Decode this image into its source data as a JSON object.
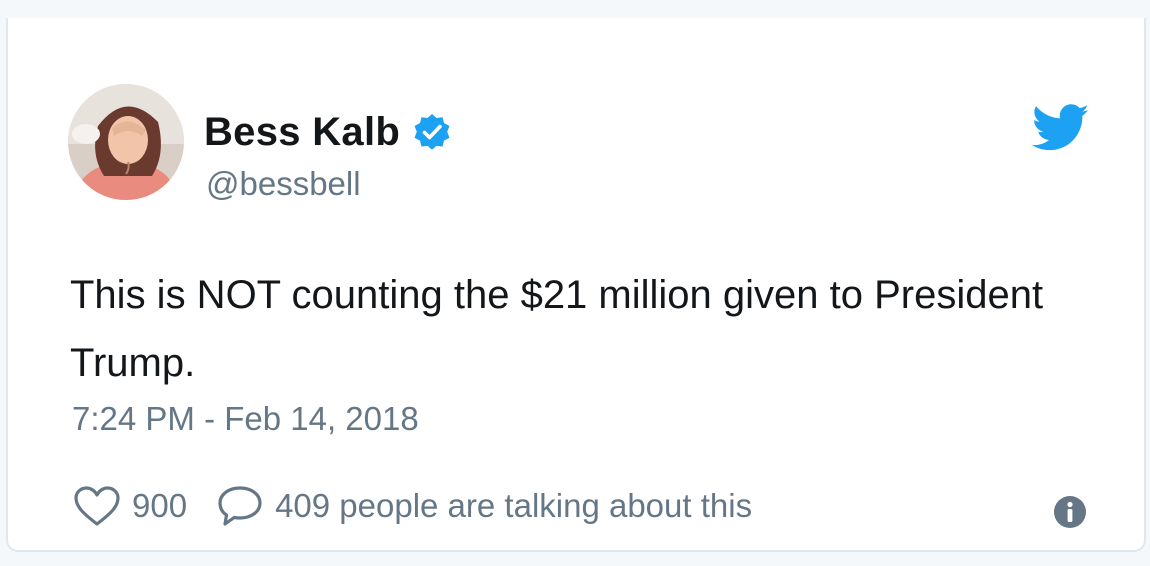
{
  "author": {
    "display_name": "Bess Kalb",
    "handle": "@bessbell",
    "verified": true
  },
  "tweet": {
    "text": "This is NOT counting the $21 million given to President Trump.",
    "timestamp": "7:24 PM - Feb 14, 2018"
  },
  "actions": {
    "like_count": "900",
    "talking_text": "409 people are talking about this"
  },
  "icons": {
    "brand": "twitter-bird-icon",
    "verified": "verified-badge-icon",
    "like": "heart-icon",
    "reply": "speech-bubble-icon",
    "info": "info-icon"
  },
  "colors": {
    "brand_blue": "#1da1f2",
    "text_primary": "#14171a",
    "text_secondary": "#657786",
    "border": "#e1e8ed"
  }
}
